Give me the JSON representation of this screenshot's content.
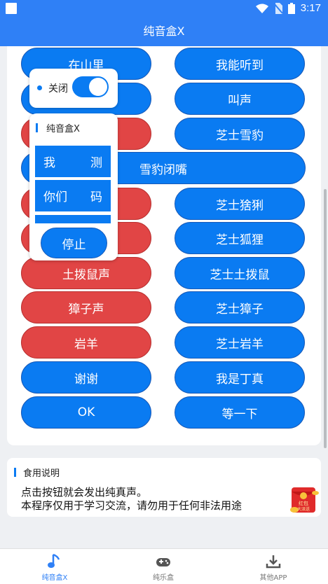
{
  "status_bar": {
    "time": "3:17"
  },
  "app_title": "纯音盒X",
  "buttons": [
    {
      "label": "在山里",
      "color": "blue"
    },
    {
      "label": "我能听到",
      "color": "blue"
    },
    {
      "label": "",
      "color": "blue"
    },
    {
      "label": "叫声",
      "color": "blue"
    },
    {
      "label": "",
      "color": "red"
    },
    {
      "label": "芝士雪豹",
      "color": "blue"
    },
    {
      "label": "雪豹闭嘴",
      "color": "blue"
    },
    {
      "label": "",
      "color": "red"
    },
    {
      "label": "芝士猞猁",
      "color": "blue"
    },
    {
      "label": "",
      "color": "red"
    },
    {
      "label": "芝士狐狸",
      "color": "blue"
    },
    {
      "label": "土拨鼠声",
      "color": "red"
    },
    {
      "label": "芝士土拨鼠",
      "color": "blue"
    },
    {
      "label": "獐子声",
      "color": "red"
    },
    {
      "label": "芝士獐子",
      "color": "blue"
    },
    {
      "label": "岩羊",
      "color": "red"
    },
    {
      "label": "芝士岩羊",
      "color": "blue"
    },
    {
      "label": "谢谢",
      "color": "blue"
    },
    {
      "label": "我是丁真",
      "color": "blue"
    },
    {
      "label": "OK",
      "color": "blue"
    },
    {
      "label": "等一下",
      "color": "blue"
    }
  ],
  "toggle_overlay": {
    "label": "关闭",
    "on": true
  },
  "float_panel": {
    "title": "纯音盒X",
    "rows": [
      {
        "left": "我",
        "right": "测"
      },
      {
        "left": "你们",
        "right": "码"
      }
    ],
    "stop_label": "停止"
  },
  "info_card": {
    "title": "食用说明",
    "line1": "点击按钮就会发出纯真声。",
    "line2": "本程序仅用于学习交流，请勿用于任何非法用途"
  },
  "red_packet": {
    "line1": "红包",
    "line2": "大派送"
  },
  "tabs": [
    {
      "label": "纯音盒X",
      "icon": "music-note-icon",
      "active": true
    },
    {
      "label": "纯乐盒",
      "icon": "gamepad-icon",
      "active": false
    },
    {
      "label": "其他APP",
      "icon": "download-icon",
      "active": false
    }
  ],
  "colors": {
    "primary": "#2f80f6",
    "button_blue": "#0a7bf2",
    "button_red": "#e14545"
  }
}
